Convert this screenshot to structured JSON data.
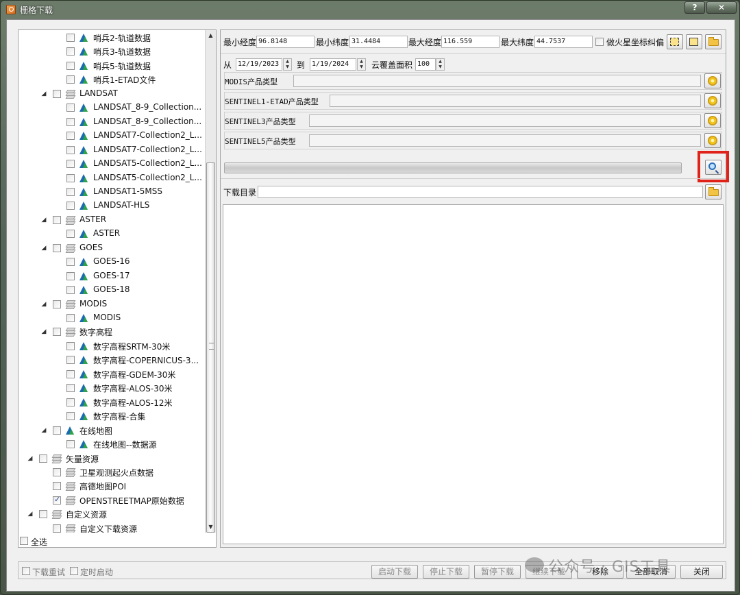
{
  "window": {
    "title": "栅格下载",
    "help_label": "?",
    "close_label": "✕"
  },
  "tree": {
    "items": [
      {
        "label": "哨兵2-轨道数据",
        "level": 2,
        "checked": false,
        "icon": "raster-icon",
        "expander": ""
      },
      {
        "label": "哨兵3-轨道数据",
        "level": 2,
        "checked": false,
        "icon": "raster-icon",
        "expander": ""
      },
      {
        "label": "哨兵5-轨道数据",
        "level": 2,
        "checked": false,
        "icon": "raster-icon",
        "expander": ""
      },
      {
        "label": "哨兵1-ETAD文件",
        "level": 2,
        "checked": false,
        "icon": "raster-icon",
        "expander": ""
      },
      {
        "label": "LANDSAT",
        "level": 1,
        "checked": false,
        "icon": "layers-icon",
        "expander": "◢"
      },
      {
        "label": "LANDSAT_8-9_Collection...",
        "level": 2,
        "checked": false,
        "icon": "raster-icon",
        "expander": ""
      },
      {
        "label": "LANDSAT_8-9_Collection...",
        "level": 2,
        "checked": false,
        "icon": "raster-icon",
        "expander": ""
      },
      {
        "label": "LANDSAT7-Collection2_L...",
        "level": 2,
        "checked": false,
        "icon": "raster-icon",
        "expander": ""
      },
      {
        "label": "LANDSAT7-Collection2_L...",
        "level": 2,
        "checked": false,
        "icon": "raster-icon",
        "expander": ""
      },
      {
        "label": "LANDSAT5-Collection2_L...",
        "level": 2,
        "checked": false,
        "icon": "raster-icon",
        "expander": ""
      },
      {
        "label": "LANDSAT5-Collection2_L...",
        "level": 2,
        "checked": false,
        "icon": "raster-icon",
        "expander": ""
      },
      {
        "label": "LANDSAT1-5MSS",
        "level": 2,
        "checked": false,
        "icon": "raster-icon",
        "expander": ""
      },
      {
        "label": "LANDSAT-HLS",
        "level": 2,
        "checked": false,
        "icon": "raster-icon",
        "expander": ""
      },
      {
        "label": "ASTER",
        "level": 1,
        "checked": false,
        "icon": "layers-icon",
        "expander": "◢"
      },
      {
        "label": "ASTER",
        "level": 2,
        "checked": false,
        "icon": "raster-icon",
        "expander": ""
      },
      {
        "label": "GOES",
        "level": 1,
        "checked": false,
        "icon": "layers-icon",
        "expander": "◢"
      },
      {
        "label": "GOES-16",
        "level": 2,
        "checked": false,
        "icon": "raster-icon",
        "expander": ""
      },
      {
        "label": "GOES-17",
        "level": 2,
        "checked": false,
        "icon": "raster-icon",
        "expander": ""
      },
      {
        "label": "GOES-18",
        "level": 2,
        "checked": false,
        "icon": "raster-icon",
        "expander": ""
      },
      {
        "label": "MODIS",
        "level": 1,
        "checked": false,
        "icon": "layers-icon",
        "expander": "◢"
      },
      {
        "label": "MODIS",
        "level": 2,
        "checked": false,
        "icon": "raster-icon",
        "expander": ""
      },
      {
        "label": "数字高程",
        "level": 1,
        "checked": false,
        "icon": "layers-icon",
        "expander": "◢"
      },
      {
        "label": "数字高程SRTM-30米",
        "level": 2,
        "checked": false,
        "icon": "raster-icon",
        "expander": ""
      },
      {
        "label": "数字高程-COPERNICUS-3...",
        "level": 2,
        "checked": false,
        "icon": "raster-icon",
        "expander": ""
      },
      {
        "label": "数字高程-GDEM-30米",
        "level": 2,
        "checked": false,
        "icon": "raster-icon",
        "expander": ""
      },
      {
        "label": "数字高程-ALOS-30米",
        "level": 2,
        "checked": false,
        "icon": "raster-icon",
        "expander": ""
      },
      {
        "label": "数字高程-ALOS-12米",
        "level": 2,
        "checked": false,
        "icon": "raster-icon",
        "expander": ""
      },
      {
        "label": "数字高程-合集",
        "level": 2,
        "checked": false,
        "icon": "raster-icon",
        "expander": ""
      },
      {
        "label": "在线地图",
        "level": 1,
        "checked": false,
        "icon": "raster-icon",
        "expander": "◢"
      },
      {
        "label": "在线地图--数据源",
        "level": 2,
        "checked": false,
        "icon": "raster-icon",
        "expander": ""
      },
      {
        "label": "矢量资源",
        "level": 0,
        "checked": false,
        "icon": "layers-icon",
        "expander": "◢"
      },
      {
        "label": "卫星观测起火点数据",
        "level": 1,
        "checked": false,
        "icon": "layers-icon",
        "expander": ""
      },
      {
        "label": "高德地图POI",
        "level": 1,
        "checked": false,
        "icon": "layers-icon",
        "expander": ""
      },
      {
        "label": "OPENSTREETMAP原始数据",
        "level": 1,
        "checked": true,
        "icon": "layers-icon",
        "expander": ""
      },
      {
        "label": "自定义资源",
        "level": 0,
        "checked": false,
        "icon": "layers-icon",
        "expander": "◢"
      },
      {
        "label": "自定义下载资源",
        "level": 1,
        "checked": false,
        "icon": "layers-icon",
        "expander": ""
      }
    ],
    "select_all_label": "全选"
  },
  "bbox": {
    "min_lon_label": "最小经度",
    "min_lon": "96.8148",
    "min_lat_label": "最小纬度",
    "min_lat": "31.4484",
    "max_lon_label": "最大经度",
    "max_lon": "116.559",
    "max_lat_label": "最大纬度",
    "max_lat": "44.7537",
    "mars_label": "做火星坐标纠偏"
  },
  "date": {
    "from_label": "从",
    "from": "12/19/2023",
    "to_label": "到",
    "to": "1/19/2024",
    "cloud_label": "云覆盖面积",
    "cloud": "100"
  },
  "products": {
    "modis_label": "MODIS产品类型",
    "sentinel1_label": "SENTINEL1-ETAD产品类型",
    "sentinel3_label": "SENTINEL3产品类型",
    "sentinel5_label": "SENTINEL5产品类型"
  },
  "download_dir": {
    "label": "下载目录",
    "value": ""
  },
  "buttons": {
    "start": "启动下载",
    "stop": "停止下载",
    "pause": "暂停下载",
    "resume": "继续下载",
    "remove": "移除",
    "cancel_all": "全部取消",
    "close": "关闭"
  },
  "options": {
    "retry_label": "下载重试",
    "timer_label": "定时启动"
  },
  "watermark": "公众号 · GIS工具"
}
